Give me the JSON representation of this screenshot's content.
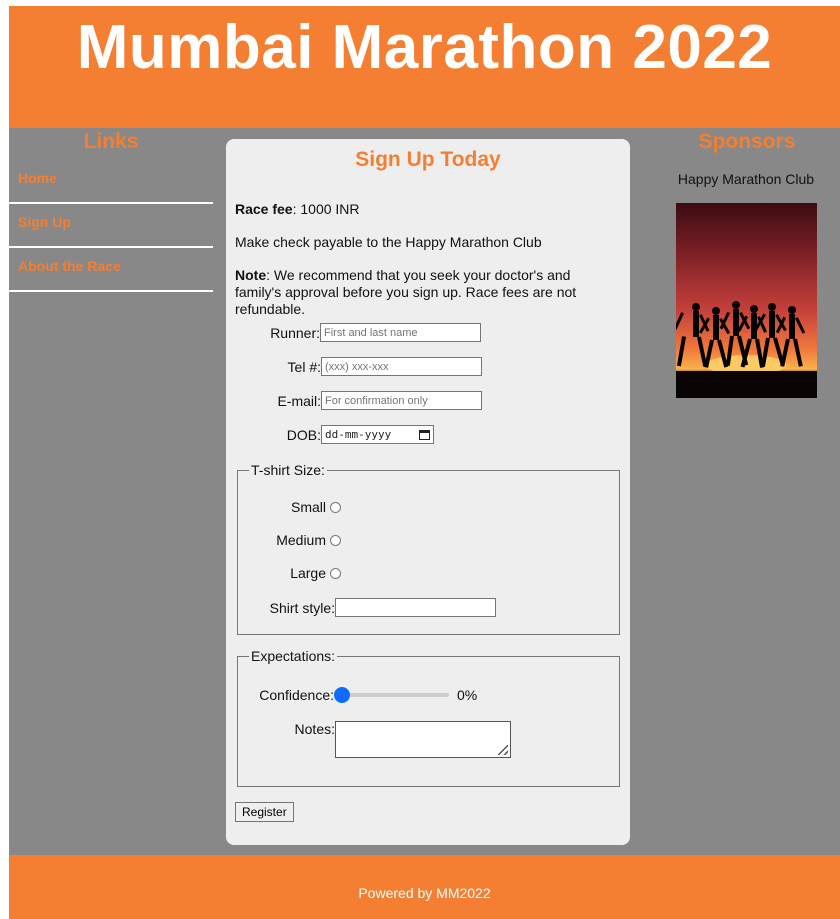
{
  "header": {
    "title": "Mumbai Marathon 2022"
  },
  "links": {
    "title": "Links",
    "items": [
      {
        "label": "Home"
      },
      {
        "label": "Sign Up"
      },
      {
        "label": "About the Race"
      }
    ]
  },
  "sponsors": {
    "title": "Sponsors",
    "name": "Happy Marathon Club"
  },
  "form": {
    "title": "Sign Up Today",
    "race_fee_label": "Race fee",
    "race_fee_value": ": 1000 INR",
    "check_text": "Make check payable to the Happy Marathon Club",
    "note_label": "Note",
    "note_text": ": We recommend that you seek your doctor's and family's approval before you sign up. Race fees are not refundable.",
    "runner": {
      "label": "Runner:",
      "placeholder": "First and last name"
    },
    "tel": {
      "label": "Tel #:",
      "placeholder": "(xxx) xxx-xxx"
    },
    "email": {
      "label": "E-mail:",
      "placeholder": "For confirmation only"
    },
    "dob": {
      "label": "DOB:",
      "value": "dd-mm-yyyy"
    },
    "tshirt": {
      "legend": "T-shirt Size:",
      "options": [
        "Small",
        "Medium",
        "Large"
      ],
      "style_label": "Shirt style:"
    },
    "expectations": {
      "legend": "Expectations:",
      "confidence_label": "Confidence:",
      "confidence_value": "0%",
      "confidence_level": 0,
      "notes_label": "Notes:"
    },
    "register_label": "Register"
  },
  "footer": {
    "text": "Powered by MM2022"
  },
  "colors": {
    "accent": "#f47f32",
    "middle_bg": "#888888",
    "card_bg": "#eeeeee",
    "slider": "#0f6bff"
  }
}
